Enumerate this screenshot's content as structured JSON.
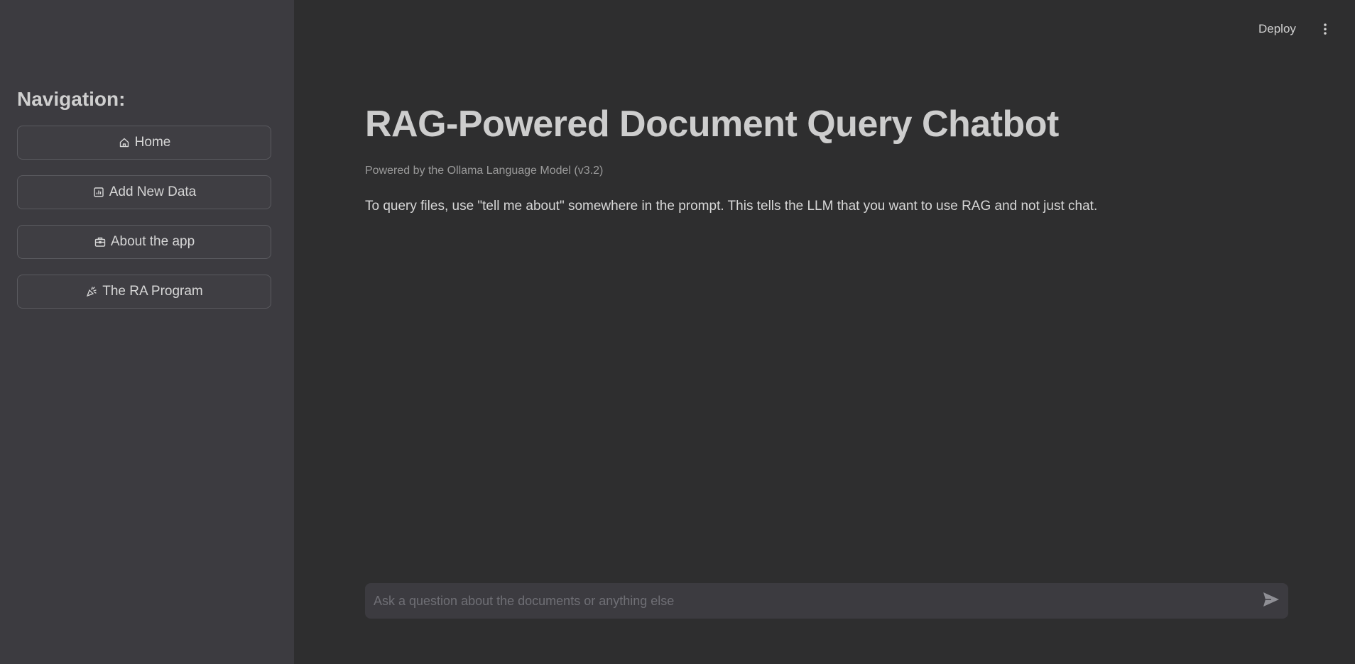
{
  "sidebar": {
    "title": "Navigation:",
    "items": [
      {
        "label": "Home",
        "icon": "home-icon"
      },
      {
        "label": "Add New Data",
        "icon": "chart-icon"
      },
      {
        "label": "About the app",
        "icon": "briefcase-icon"
      },
      {
        "label": "The RA Program",
        "icon": "party-popper-icon"
      }
    ]
  },
  "header": {
    "deploy_label": "Deploy",
    "menu_icon": "kebab-menu-icon"
  },
  "main": {
    "title": "RAG-Powered Document Query Chatbot",
    "subtitle": "Powered by the Ollama Language Model (v3.2)",
    "intro": "To query files, use \"tell me about\" somewhere in the prompt. This tells the LLM that you want to use RAG and not just chat."
  },
  "chat": {
    "placeholder": "Ask a question about the documents or anything else",
    "value": "",
    "send_icon": "send-icon"
  },
  "colors": {
    "sidebar_bg": "#3c3b40",
    "main_bg": "#2e2e2f",
    "text": "#cdcdcd"
  }
}
